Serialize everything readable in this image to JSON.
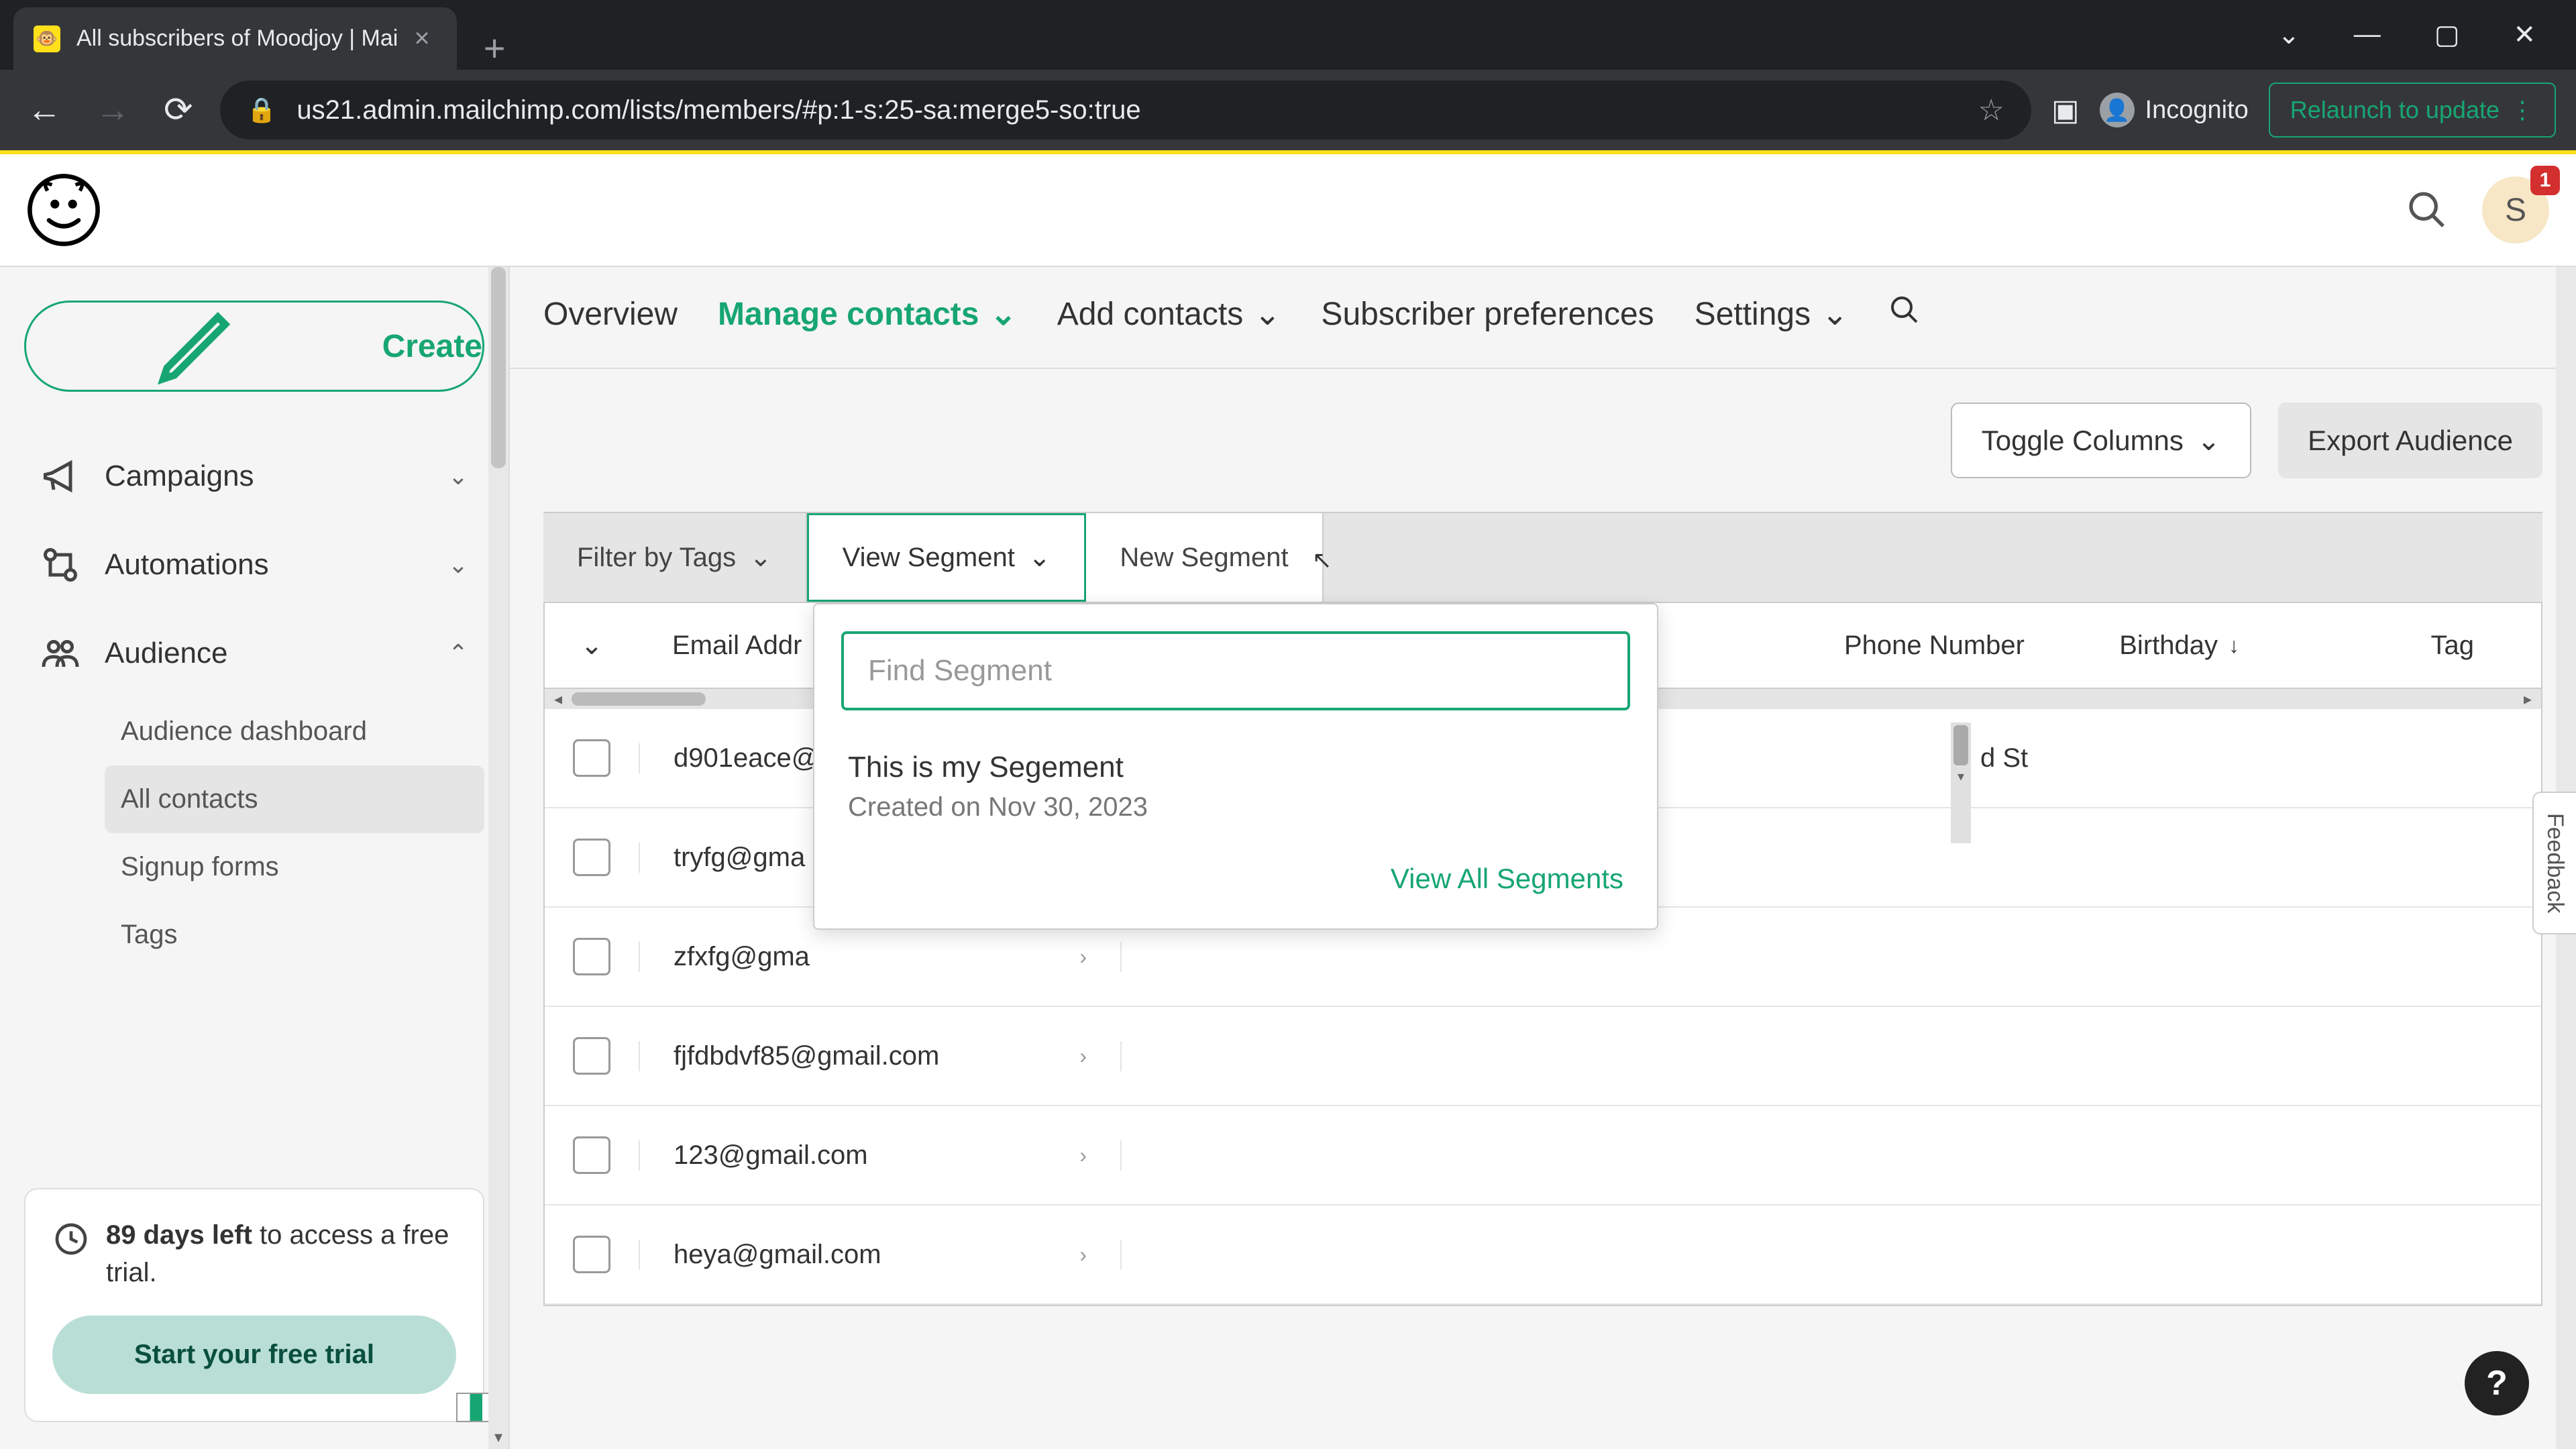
{
  "browser": {
    "tab_title": "All subscribers of Moodjoy | Mai",
    "url": "us21.admin.mailchimp.com/lists/members/#p:1-s:25-sa:merge5-so:true",
    "incognito_label": "Incognito",
    "relaunch_label": "Relaunch to update"
  },
  "header": {
    "avatar_letter": "S",
    "badge_count": "1"
  },
  "sidebar": {
    "create_label": "Create",
    "items": [
      {
        "label": "Campaigns"
      },
      {
        "label": "Automations"
      },
      {
        "label": "Audience"
      }
    ],
    "audience_sub": [
      {
        "label": "Audience dashboard"
      },
      {
        "label": "All contacts"
      },
      {
        "label": "Signup forms"
      },
      {
        "label": "Tags"
      }
    ],
    "trial": {
      "days_bold": "89 days left",
      "days_rest": " to access a free trial.",
      "cta": "Start your free trial"
    }
  },
  "tabs": {
    "overview": "Overview",
    "manage": "Manage contacts",
    "add": "Add contacts",
    "prefs": "Subscriber preferences",
    "settings": "Settings"
  },
  "controls": {
    "toggle_columns": "Toggle Columns",
    "export": "Export Audience"
  },
  "filters": {
    "filter_tags": "Filter by Tags",
    "view_segment": "View Segment",
    "new_segment": "New Segment"
  },
  "table": {
    "columns": {
      "email": "Email Addr",
      "phone": "Phone Number",
      "birthday": "Birthday",
      "tag": "Tag"
    },
    "row_extra_address": "d St",
    "rows": [
      {
        "email": "d901eace@"
      },
      {
        "email": "tryfg@gma"
      },
      {
        "email": "zfxfg@gma"
      },
      {
        "email": "fjfdbdvf85@gmail.com"
      },
      {
        "email": "123@gmail.com"
      },
      {
        "email": "heya@gmail.com"
      }
    ]
  },
  "popover": {
    "placeholder": "Find Segment",
    "segment_name": "This is my Segement",
    "segment_date": "Created on Nov 30, 2023",
    "view_all": "View All Segments"
  },
  "widgets": {
    "feedback": "Feedback",
    "help": "?"
  }
}
